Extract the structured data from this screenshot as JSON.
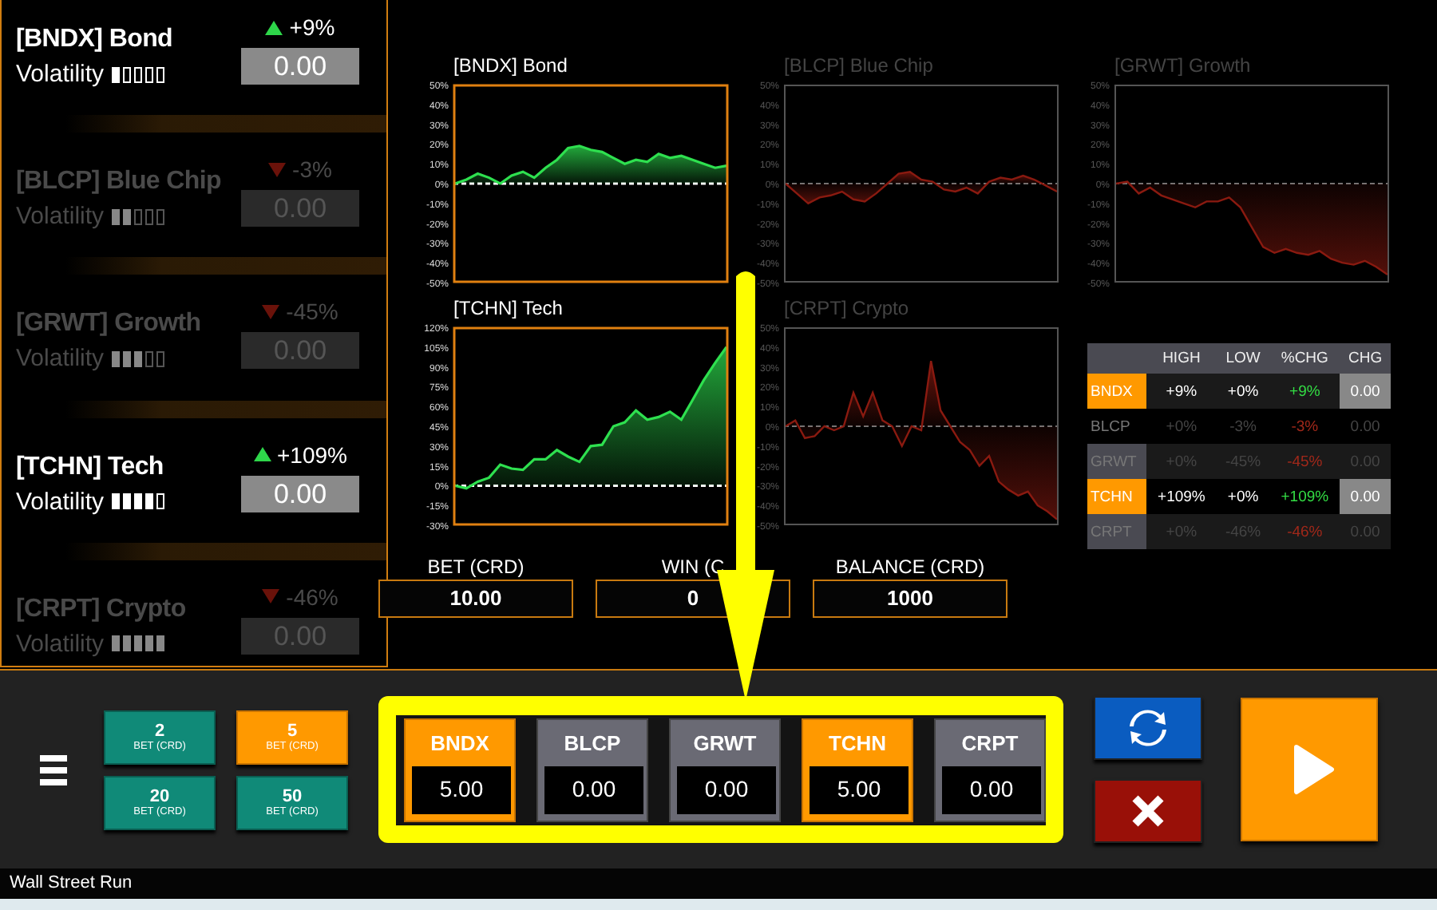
{
  "assets": [
    {
      "name": "[BNDX] Bond",
      "volatility_label": "Volatility",
      "stars": 1,
      "rising": true,
      "change": "+9%",
      "value": "0.00",
      "selected": true
    },
    {
      "name": "[BLCP] Blue Chip",
      "volatility_label": "Volatility",
      "stars": 2,
      "rising": false,
      "change": "-3%",
      "value": "0.00",
      "selected": false
    },
    {
      "name": "[GRWT] Growth",
      "volatility_label": "Volatility",
      "stars": 3,
      "rising": false,
      "change": "-45%",
      "value": "0.00",
      "selected": false
    },
    {
      "name": "[TCHN] Tech",
      "volatility_label": "Volatility",
      "stars": 4,
      "rising": true,
      "change": "+109%",
      "value": "0.00",
      "selected": true
    },
    {
      "name": "[CRPT] Crypto",
      "volatility_label": "Volatility",
      "stars": 5,
      "rising": false,
      "change": "-46%",
      "value": "0.00",
      "selected": false
    }
  ],
  "charts": [
    {
      "selected": true,
      "chart_data": {
        "type": "area",
        "title": "[BNDX] Bond",
        "ylim": [
          -50,
          50
        ],
        "yticks": [
          {
            "value": 50,
            "label": "50%"
          },
          {
            "value": 40,
            "label": "40%"
          },
          {
            "value": 30,
            "label": "30%"
          },
          {
            "value": 20,
            "label": "20%"
          },
          {
            "value": 10,
            "label": "10%"
          },
          {
            "value": 0,
            "label": "0%"
          },
          {
            "value": -10,
            "label": "-10%"
          },
          {
            "value": -20,
            "label": "-20%"
          },
          {
            "value": -30,
            "label": "-30%"
          },
          {
            "value": -40,
            "label": "-40%"
          },
          {
            "value": -50,
            "label": "-50%"
          }
        ],
        "series": [
          {
            "color": "#2ee04f",
            "values": [
              0,
              2,
              5,
              3,
              0,
              4,
              6,
              3,
              8,
              12,
              18,
              19,
              17,
              16,
              13,
              10,
              12,
              11,
              15,
              13,
              14,
              12,
              10,
              8,
              9
            ]
          }
        ]
      }
    },
    {
      "selected": false,
      "chart_data": {
        "type": "area",
        "title": "[BLCP] Blue Chip",
        "ylim": [
          -50,
          50
        ],
        "yticks": [
          {
            "value": 50,
            "label": "50%"
          },
          {
            "value": 40,
            "label": "40%"
          },
          {
            "value": 30,
            "label": "30%"
          },
          {
            "value": 20,
            "label": "20%"
          },
          {
            "value": 10,
            "label": "10%"
          },
          {
            "value": 0,
            "label": "0%"
          },
          {
            "value": -10,
            "label": "-10%"
          },
          {
            "value": -20,
            "label": "-20%"
          },
          {
            "value": -30,
            "label": "-30%"
          },
          {
            "value": -40,
            "label": "-40%"
          },
          {
            "value": -50,
            "label": "-50%"
          }
        ],
        "series": [
          {
            "color": "#8a1a10",
            "values": [
              0,
              -5,
              -10,
              -7,
              -6,
              -4,
              -8,
              -9,
              -5,
              0,
              5,
              6,
              2,
              1,
              -3,
              -4,
              -2,
              -5,
              1,
              3,
              2,
              4,
              2,
              -1,
              -4
            ]
          }
        ]
      }
    },
    {
      "selected": false,
      "chart_data": {
        "type": "area",
        "title": "[GRWT] Growth",
        "ylim": [
          -50,
          50
        ],
        "yticks": [
          {
            "value": 50,
            "label": "50%"
          },
          {
            "value": 40,
            "label": "40%"
          },
          {
            "value": 30,
            "label": "30%"
          },
          {
            "value": 20,
            "label": "20%"
          },
          {
            "value": 10,
            "label": "10%"
          },
          {
            "value": 0,
            "label": "0%"
          },
          {
            "value": -10,
            "label": "-10%"
          },
          {
            "value": -20,
            "label": "-20%"
          },
          {
            "value": -30,
            "label": "-30%"
          },
          {
            "value": -40,
            "label": "-40%"
          },
          {
            "value": -50,
            "label": "-50%"
          }
        ],
        "series": [
          {
            "color": "#8a1a10",
            "values": [
              0,
              1,
              -5,
              -2,
              -6,
              -8,
              -10,
              -12,
              -9,
              -9,
              -7,
              -12,
              -22,
              -32,
              -35,
              -33,
              -35,
              -36,
              -34,
              -38,
              -40,
              -41,
              -39,
              -42,
              -46
            ]
          }
        ]
      }
    },
    {
      "selected": true,
      "chart_data": {
        "type": "area",
        "title": "[TCHN] Tech",
        "ylim": [
          -30,
          120
        ],
        "yticks": [
          {
            "value": 120,
            "label": "120%"
          },
          {
            "value": 105,
            "label": "105%"
          },
          {
            "value": 90,
            "label": "90%"
          },
          {
            "value": 75,
            "label": "75%"
          },
          {
            "value": 60,
            "label": "60%"
          },
          {
            "value": 45,
            "label": "45%"
          },
          {
            "value": 30,
            "label": "30%"
          },
          {
            "value": 15,
            "label": "15%"
          },
          {
            "value": 0,
            "label": "0%"
          },
          {
            "value": -15,
            "label": "-15%"
          },
          {
            "value": -30,
            "label": "-30%"
          }
        ],
        "series": [
          {
            "color": "#2ee04f",
            "values": [
              0,
              -2,
              3,
              6,
              16,
              13,
              12,
              20,
              20,
              27,
              22,
              18,
              30,
              31,
              45,
              48,
              57,
              50,
              52,
              56,
              50,
              65,
              80,
              93,
              105
            ]
          }
        ]
      }
    },
    {
      "selected": false,
      "chart_data": {
        "type": "area",
        "title": "[CRPT] Crypto",
        "ylim": [
          -50,
          50
        ],
        "yticks": [
          {
            "value": 50,
            "label": "50%"
          },
          {
            "value": 40,
            "label": "40%"
          },
          {
            "value": 30,
            "label": "30%"
          },
          {
            "value": 20,
            "label": "20%"
          },
          {
            "value": 10,
            "label": "10%"
          },
          {
            "value": 0,
            "label": "0%"
          },
          {
            "value": -10,
            "label": "-10%"
          },
          {
            "value": -20,
            "label": "-20%"
          },
          {
            "value": -30,
            "label": "-30%"
          },
          {
            "value": -40,
            "label": "-40%"
          },
          {
            "value": -50,
            "label": "-50%"
          }
        ],
        "series": [
          {
            "color": "#8a1a10",
            "values": [
              0,
              3,
              -6,
              -5,
              0,
              -2,
              0,
              17,
              5,
              17,
              3,
              0,
              -10,
              0,
              -2,
              33,
              8,
              0,
              -8,
              -12,
              -20,
              -15,
              -28,
              -32,
              -35,
              -33,
              -40,
              -43,
              -47
            ]
          }
        ]
      }
    }
  ],
  "table": {
    "columns": [
      "HIGH",
      "LOW",
      "%CHG",
      "CHG"
    ],
    "rows": [
      {
        "code": "BNDX",
        "high": "+9%",
        "low": "+0%",
        "pct": "+9%",
        "rising": true,
        "chg": "0.00",
        "selected": true
      },
      {
        "code": "BLCP",
        "high": "+0%",
        "low": "-3%",
        "pct": "-3%",
        "rising": false,
        "chg": "0.00",
        "selected": false
      },
      {
        "code": "GRWT",
        "high": "+0%",
        "low": "-45%",
        "pct": "-45%",
        "rising": false,
        "chg": "0.00",
        "selected": false
      },
      {
        "code": "TCHN",
        "high": "+109%",
        "low": "+0%",
        "pct": "+109%",
        "rising": true,
        "chg": "0.00",
        "selected": true
      },
      {
        "code": "CRPT",
        "high": "+0%",
        "low": "-46%",
        "pct": "-46%",
        "rising": false,
        "chg": "0.00",
        "selected": false
      }
    ]
  },
  "readouts": [
    {
      "label": "BET (CRD)",
      "value": "10.00"
    },
    {
      "label": "WIN (C",
      "value": "0"
    },
    {
      "label": "BALANCE (CRD)",
      "value": "1000"
    }
  ],
  "chips": [
    {
      "amount": "2",
      "caption": "BET (CRD)",
      "selected": false
    },
    {
      "amount": "5",
      "caption": "BET (CRD)",
      "selected": true
    },
    {
      "amount": "20",
      "caption": "BET (CRD)",
      "selected": false
    },
    {
      "amount": "50",
      "caption": "BET (CRD)",
      "selected": false
    }
  ],
  "asset_bets": [
    {
      "code": "BNDX",
      "amount": "5.00",
      "selected": true
    },
    {
      "code": "BLCP",
      "amount": "0.00",
      "selected": false
    },
    {
      "code": "GRWT",
      "amount": "0.00",
      "selected": false
    },
    {
      "code": "TCHN",
      "amount": "5.00",
      "selected": true
    },
    {
      "code": "CRPT",
      "amount": "0.00",
      "selected": false
    }
  ],
  "status_bar": "Wall Street Run"
}
